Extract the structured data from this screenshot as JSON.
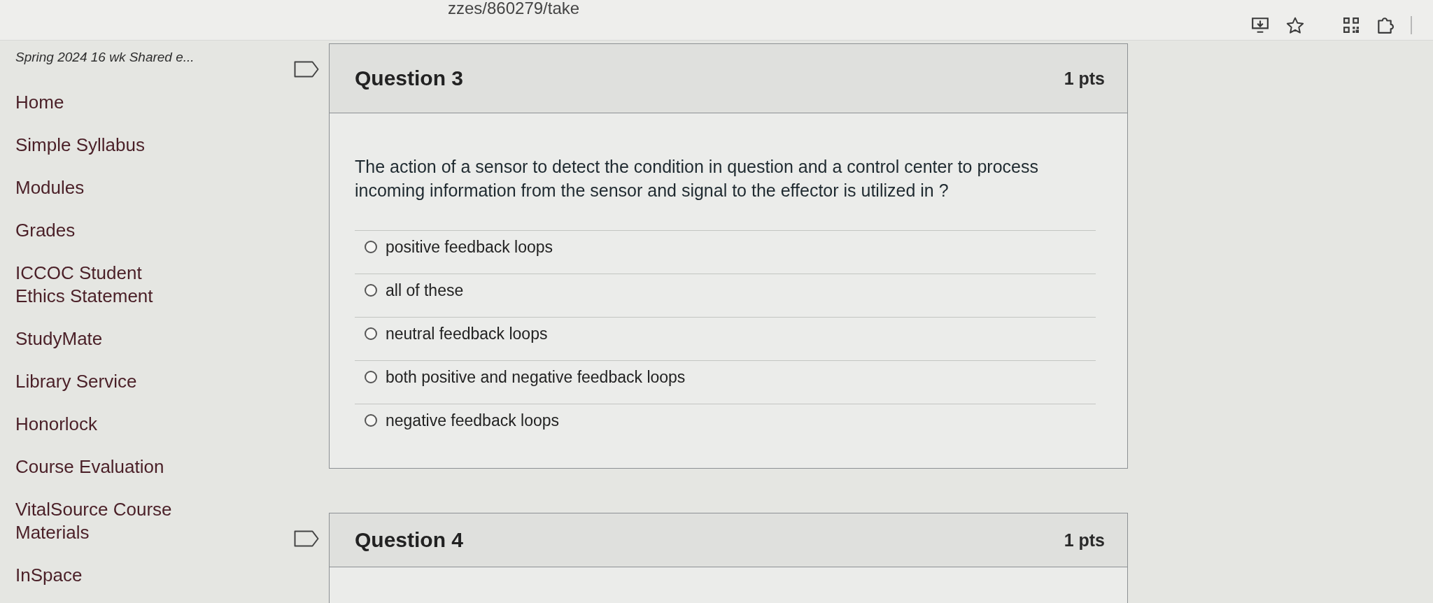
{
  "browser": {
    "url": "zzes/860279/take"
  },
  "sidebar": {
    "course_title": "Spring 2024 16 wk Shared e...",
    "items": [
      "Home",
      "Simple Syllabus",
      "Modules",
      "Grades",
      "ICCOC Student Ethics Statement",
      "StudyMate",
      "Library Service",
      "Honorlock",
      "Course Evaluation",
      "VitalSource Course Materials",
      "InSpace"
    ]
  },
  "questions": [
    {
      "title": "Question 3",
      "points": "1 pts",
      "flagged": false,
      "text": "The action of a sensor to detect the condition in question and a control center to process incoming information from the sensor and signal to the effector is utilized in ?",
      "answers": [
        {
          "label": "positive feedback loops",
          "selected": false
        },
        {
          "label": "all of these",
          "selected": false
        },
        {
          "label": "neutral feedback loops",
          "selected": false
        },
        {
          "label": "both positive and negative feedback loops",
          "selected": false
        },
        {
          "label": "negative feedback loops",
          "selected": false
        }
      ]
    },
    {
      "title": "Question 4",
      "points": "1 pts",
      "flagged": false
    }
  ]
}
